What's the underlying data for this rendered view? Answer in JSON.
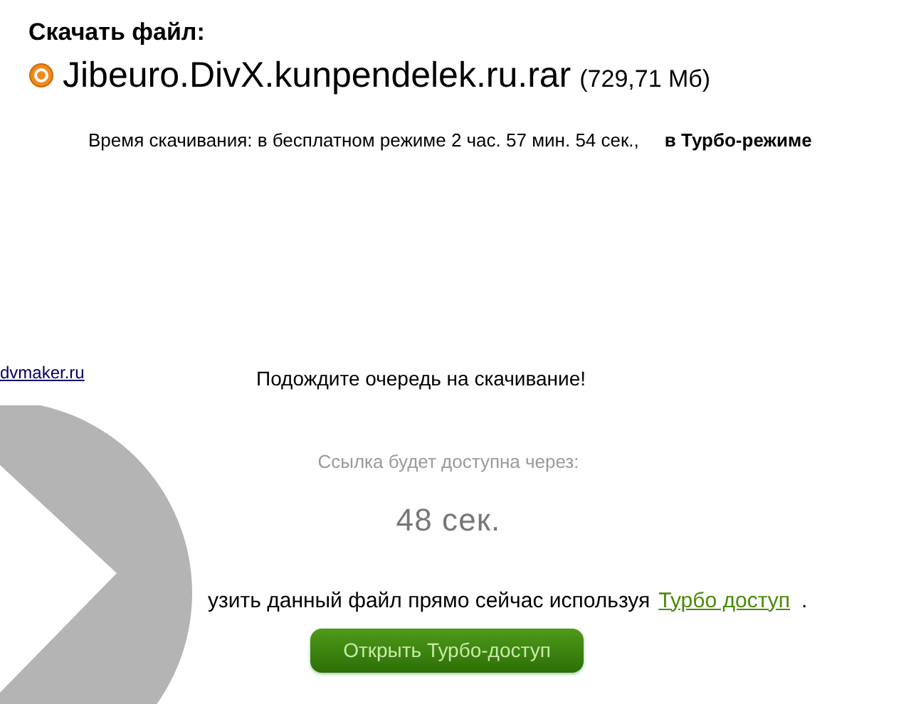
{
  "header": {
    "title": "Скачать файл:",
    "file_name": "Jibeuro.DivX.kunpendelek.ru.rar",
    "file_size": "(729,71 Мб)"
  },
  "download_time": {
    "text": "Время скачивания: в бесплатном режиме 2 час. 57 мин. 54 сек.,",
    "turbo_text": "в Турбо-режиме"
  },
  "side_link": "dvmaker.ru",
  "queue_message": "Подождите очередь на скачивание!",
  "countdown": {
    "label": "Ссылка будет доступна через:",
    "value": "48 сек."
  },
  "turbo_offer": {
    "text": "узить данный файл прямо сейчас используя",
    "link": "Турбо доступ",
    "end": "."
  },
  "turbo_button": "Открыть Турбо-доступ"
}
